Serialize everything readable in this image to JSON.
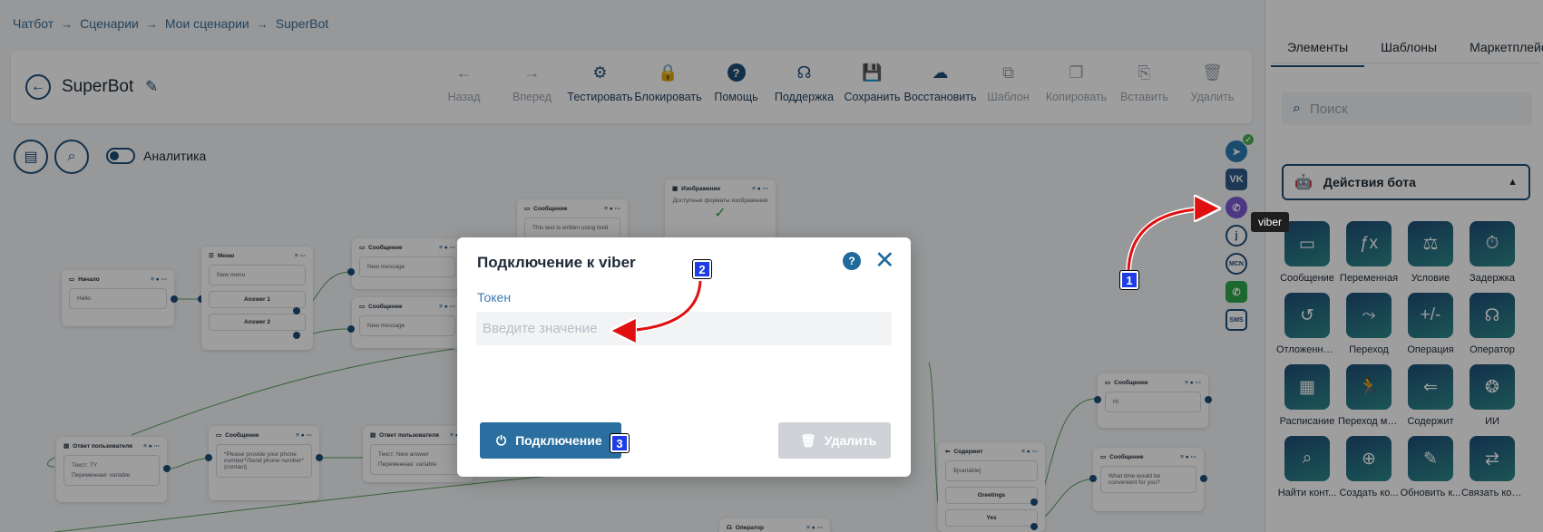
{
  "breadcrumb": [
    "Чатбот",
    "Сценарии",
    "Мои сценарии",
    "SuperBot"
  ],
  "bot_title": "SuperBot",
  "toolbar": [
    {
      "label": "Назад",
      "icon": "arrow-left-icon",
      "glyph": "←",
      "disabled": true
    },
    {
      "label": "Вперед",
      "icon": "arrow-right-icon",
      "glyph": "→",
      "disabled": true
    },
    {
      "label": "Тестировать",
      "icon": "gear-icon",
      "glyph": "⚙",
      "disabled": false
    },
    {
      "label": "Блокировать",
      "icon": "lock-icon",
      "glyph": "🔒",
      "disabled": false
    },
    {
      "label": "Помощь",
      "icon": "help-icon",
      "glyph": "?",
      "disabled": false,
      "filled": true
    },
    {
      "label": "Поддержка",
      "icon": "headset-icon",
      "glyph": "☊",
      "disabled": false
    },
    {
      "label": "Сохранить",
      "icon": "save-icon",
      "glyph": "💾",
      "disabled": false
    },
    {
      "label": "Восстановить",
      "icon": "cloud-restore-icon",
      "glyph": "☁",
      "disabled": false
    },
    {
      "label": "Шаблон",
      "icon": "template-icon",
      "glyph": "⧉",
      "disabled": true
    },
    {
      "label": "Копировать",
      "icon": "copy-icon",
      "glyph": "❐",
      "disabled": true
    },
    {
      "label": "Вставить",
      "icon": "paste-icon",
      "glyph": "⎘",
      "disabled": true
    },
    {
      "label": "Удалить",
      "icon": "trash-icon",
      "glyph": "🗑",
      "disabled": true
    }
  ],
  "analytics_label": "Аналитика",
  "channels": [
    {
      "name": "telegram",
      "icon": "telegram-icon",
      "glyph": "➤"
    },
    {
      "name": "vk",
      "icon": "vk-icon",
      "glyph": "VK"
    },
    {
      "name": "viber",
      "icon": "viber-icon",
      "glyph": "✆"
    },
    {
      "name": "jivo",
      "icon": "jivo-icon",
      "glyph": "j"
    },
    {
      "name": "mcn",
      "icon": "mcn-icon",
      "glyph": "MCN"
    },
    {
      "name": "whatsapp",
      "icon": "whatsapp-icon",
      "glyph": "✆"
    },
    {
      "name": "sms",
      "icon": "sms-icon",
      "glyph": "SMS"
    }
  ],
  "viber_tooltip": "viber",
  "canvas_nodes": {
    "start": {
      "title": "Начало",
      "text": "Hello"
    },
    "menu": {
      "title": "Меню",
      "text": "New menu",
      "btn1": "Answer 1",
      "btn2": "Answer 2"
    },
    "msg1": {
      "title": "Сообщение",
      "text": "New message"
    },
    "msg2": {
      "title": "Сообщение",
      "text": "New message"
    },
    "msg_bold": {
      "title": "Сообщение",
      "text": "This text is written using bold"
    },
    "image": {
      "title": "Изображение",
      "text": "Доступные форматы изображения"
    },
    "user_answer1": {
      "title": "Ответ пользователя",
      "line1": "Текст: TY",
      "line2": "Переменная: variable"
    },
    "phone_msg": {
      "title": "Сообщение",
      "text": "*Please provide your phone number*/Send phone number*(contact)"
    },
    "user_answer2": {
      "title": "Ответ пользователя",
      "line1": "Текст: New answer",
      "line2": "Переменная: variable"
    },
    "contains": {
      "title": "Содержит",
      "text": "${variable}",
      "btn1": "Greetings",
      "btn2": "Yes"
    },
    "msg_hi": {
      "title": "Сообщение",
      "text": "Hi"
    },
    "msg_time": {
      "title": "Сообщение",
      "text": "What time would be convenient for you?"
    },
    "operator": {
      "title": "Оператор"
    }
  },
  "sidepanel": {
    "tabs": [
      "Элементы",
      "Шаблоны",
      "Маркетплейс"
    ],
    "search_placeholder": "Поиск",
    "section_title": "Действия бота",
    "blocks": [
      {
        "label": "Сообщение",
        "icon": "message-icon",
        "glyph": "▭"
      },
      {
        "label": "Переменная",
        "icon": "function-icon",
        "glyph": "ƒx"
      },
      {
        "label": "Условие",
        "icon": "condition-icon",
        "glyph": "⚖"
      },
      {
        "label": "Задержка",
        "icon": "timer-icon",
        "glyph": "⏱"
      },
      {
        "label": "Отложенны...",
        "icon": "history-icon",
        "glyph": "↺"
      },
      {
        "label": "Переход",
        "icon": "route-icon",
        "glyph": "⤳"
      },
      {
        "label": "Операция",
        "icon": "plus-minus-icon",
        "glyph": "+/-"
      },
      {
        "label": "Оператор",
        "icon": "headset-icon",
        "glyph": "☊"
      },
      {
        "label": "Расписание",
        "icon": "calendar-icon",
        "glyph": "▦"
      },
      {
        "label": "Переход ме...",
        "icon": "runner-icon",
        "glyph": "🏃"
      },
      {
        "label": "Содержит",
        "icon": "contains-icon",
        "glyph": "⇐"
      },
      {
        "label": "ИИ",
        "icon": "ai-icon",
        "glyph": "❂"
      },
      {
        "label": "Найти конт...",
        "icon": "find-contact-icon",
        "glyph": "⌕"
      },
      {
        "label": "Создать ко...",
        "icon": "create-contact-icon",
        "glyph": "⊕"
      },
      {
        "label": "Обновить к...",
        "icon": "update-contact-icon",
        "glyph": "✎"
      },
      {
        "label": "Связать кон...",
        "icon": "link-contact-icon",
        "glyph": "⇄"
      }
    ]
  },
  "modal": {
    "title": "Подключение к viber",
    "token_label": "Токен",
    "token_placeholder": "Введите значение",
    "token_value": "",
    "connect_label": "Подключение",
    "delete_label": "Удалить"
  },
  "annotations": [
    "1",
    "2",
    "3"
  ],
  "colors": {
    "accent": "#1f4e79",
    "link": "#3a7ab5",
    "connect": "#2a6f9f",
    "annotation_badge": "#1e3de6",
    "annotation_arrow": "#e01010"
  }
}
